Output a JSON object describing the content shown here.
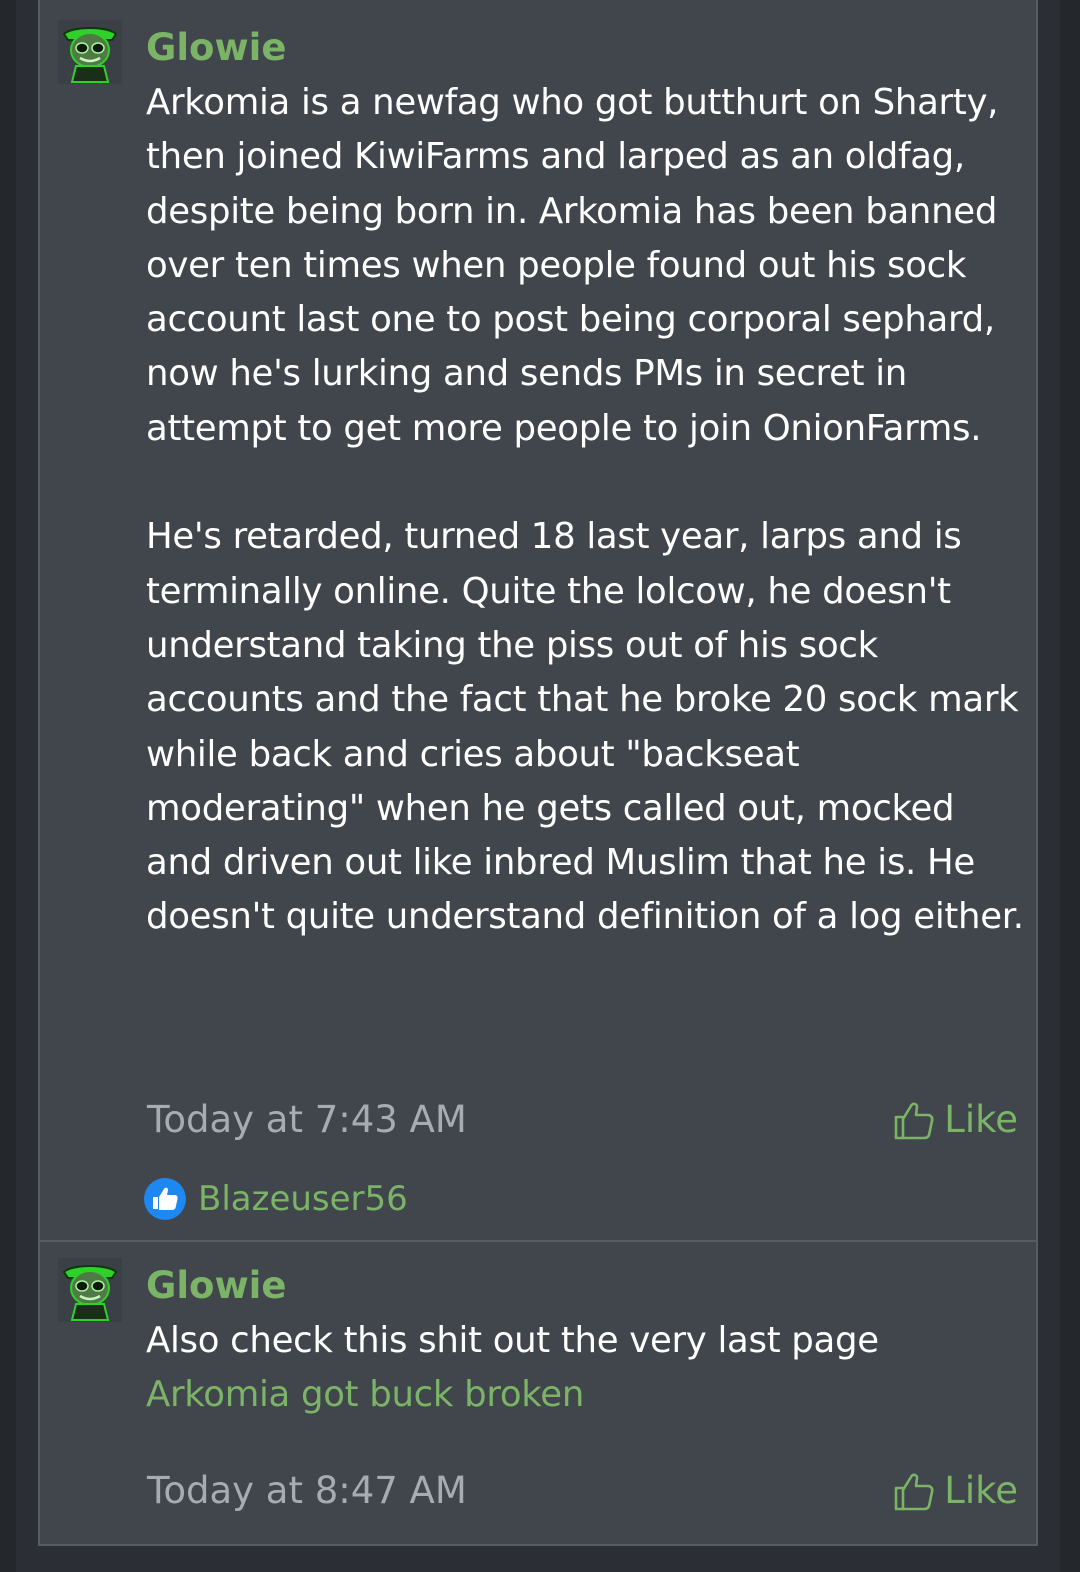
{
  "posts": [
    {
      "author": "Glowie",
      "paragraphs": [
        "Arkomia is a newfag who got butthurt on Sharty, then joined KiwiFarms and larped as an oldfag, despite being born in. Arkomia has been banned over ten times when people found out his sock account last one to post being corporal sephard, now he's lurking and sends PMs in secret in attempt to get more people to join OnionFarms.",
        "He's retarded, turned 18 last year, larps and is terminally online. Quite the lolcow, he doesn't understand taking the piss out of his sock accounts and the fact that he broke 20 sock mark while back and cries about \"backseat moderating\" when he gets called out, mocked and driven out like inbred Muslim that he is. He doesn't quite understand definition of a log either."
      ],
      "timestamp": "Today at 7:43 AM",
      "like_label": "Like",
      "likes": {
        "users": "Blazeuser56"
      }
    },
    {
      "author": "Glowie",
      "text": "Also check this shit out the very last page",
      "link_text": "Arkomia got buck broken",
      "timestamp": "Today at 8:47 AM",
      "like_label": "Like"
    }
  ],
  "colors": {
    "accent": "#7bb467",
    "background": "#41454c",
    "text": "#ffffff",
    "muted": "#a7acb1",
    "like_badge": "#1e87f0"
  },
  "icons": {
    "avatar": "alien-avatar",
    "like": "thumbs-up-icon",
    "like_badge": "thumbs-up-badge-icon"
  }
}
